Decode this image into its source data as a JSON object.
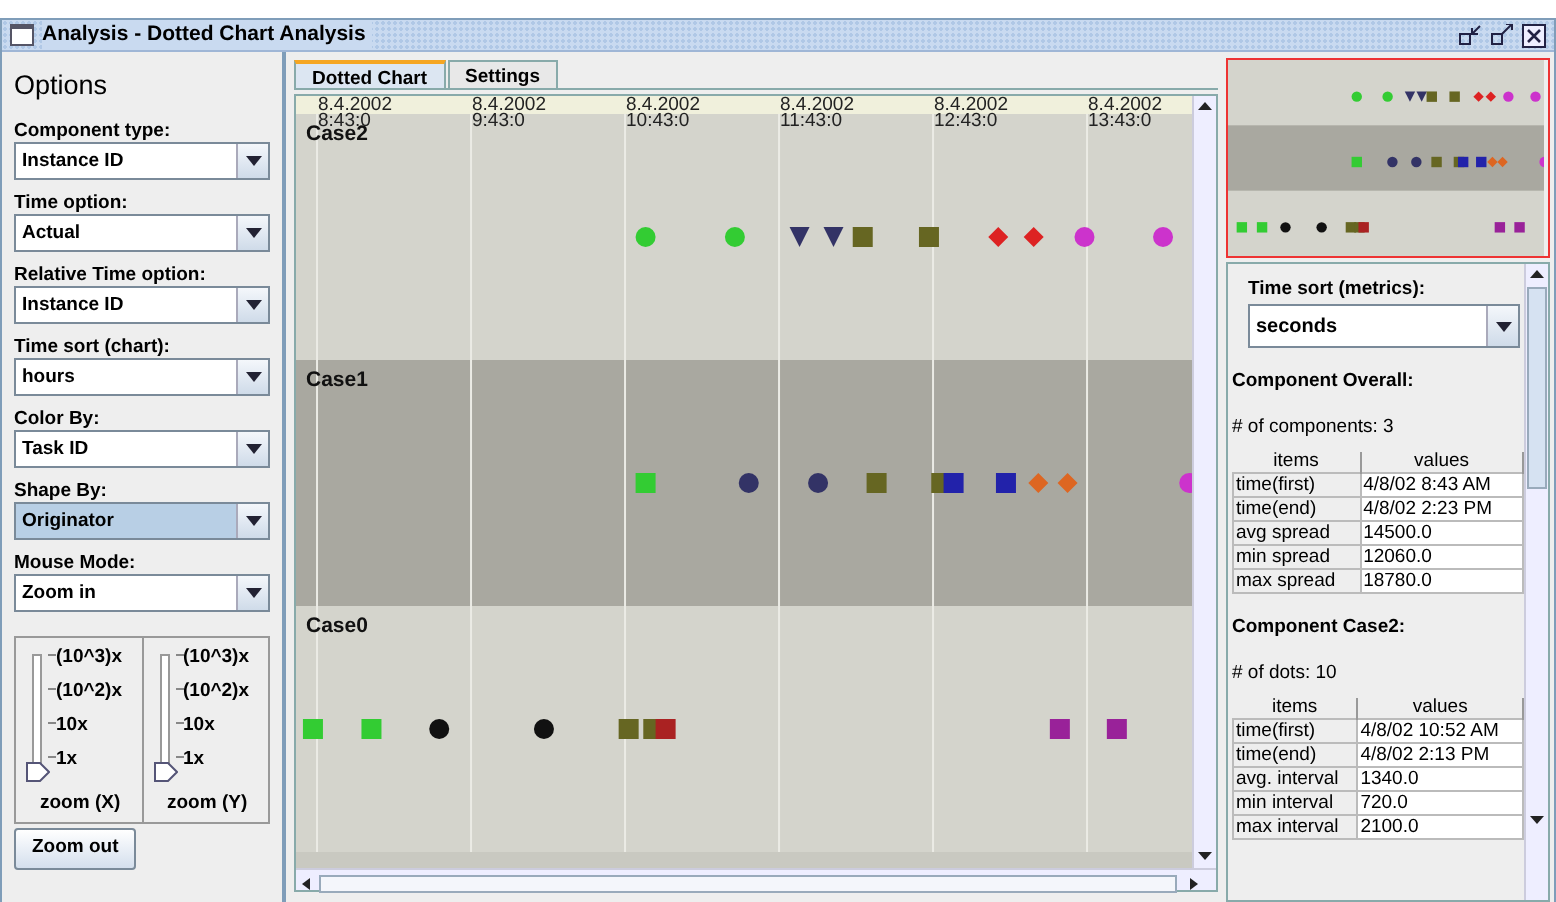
{
  "window": {
    "title": "Analysis - Dotted Chart Analysis"
  },
  "options": {
    "heading": "Options",
    "dropdowns": [
      {
        "label": "Component type:",
        "value": "Instance ID",
        "highlighted": false
      },
      {
        "label": "Time option:",
        "value": "Actual",
        "highlighted": false
      },
      {
        "label": "Relative Time option:",
        "value": "Instance ID",
        "highlighted": false
      },
      {
        "label": "Time sort (chart):",
        "value": "hours",
        "highlighted": false
      },
      {
        "label": "Color By:",
        "value": "Task ID",
        "highlighted": false
      },
      {
        "label": "Shape By:",
        "value": "Originator",
        "highlighted": true
      },
      {
        "label": "Mouse Mode:",
        "value": "Zoom in",
        "highlighted": false
      }
    ],
    "sliders": [
      {
        "ticks": [
          "(10^3)x",
          "(10^2)x",
          "10x",
          "1x"
        ],
        "caption": "zoom (X)",
        "level": 0
      },
      {
        "ticks": [
          "(10^3)x",
          "(10^2)x",
          "10x",
          "1x"
        ],
        "caption": "zoom (Y)",
        "level": 0
      }
    ],
    "zoom_out_button": "Zoom out"
  },
  "tabs": [
    {
      "label": "Dotted Chart",
      "selected": true
    },
    {
      "label": "Settings",
      "selected": false
    }
  ],
  "chart": {
    "time_labels": [
      {
        "date": "8.4.2002",
        "time": "8:43:0"
      },
      {
        "date": "8.4.2002",
        "time": "9:43:0"
      },
      {
        "date": "8.4.2002",
        "time": "10:43:0"
      },
      {
        "date": "8.4.2002",
        "time": "11:43:0"
      },
      {
        "date": "8.4.2002",
        "time": "12:43:0"
      },
      {
        "date": "8.4.2002",
        "time": "13:43:0"
      }
    ],
    "case_labels": [
      "Case2",
      "Case1",
      "Case0"
    ]
  },
  "metrics": {
    "time_sort": {
      "label": "Time sort (metrics):",
      "value": "seconds"
    },
    "sections": [
      {
        "title": "Component Overall:",
        "summary": "# of components: 3",
        "columns": [
          "items",
          "values"
        ],
        "rows": [
          [
            "time(first)",
            "4/8/02 8:43 AM"
          ],
          [
            "time(end)",
            "4/8/02 2:23 PM"
          ],
          [
            "avg spread",
            "14500.0"
          ],
          [
            "min spread",
            "12060.0"
          ],
          [
            "max spread",
            "18780.0"
          ]
        ]
      },
      {
        "title": "Component Case2:",
        "summary": "# of dots: 10",
        "columns": [
          "items",
          "values"
        ],
        "rows": [
          [
            "time(first)",
            "4/8/02 10:52 AM"
          ],
          [
            "time(end)",
            "4/8/02 2:13 PM"
          ],
          [
            "avg. interval",
            "1340.0"
          ],
          [
            "min interval",
            "720.0"
          ],
          [
            "max interval",
            "2100.0"
          ]
        ]
      }
    ]
  }
}
